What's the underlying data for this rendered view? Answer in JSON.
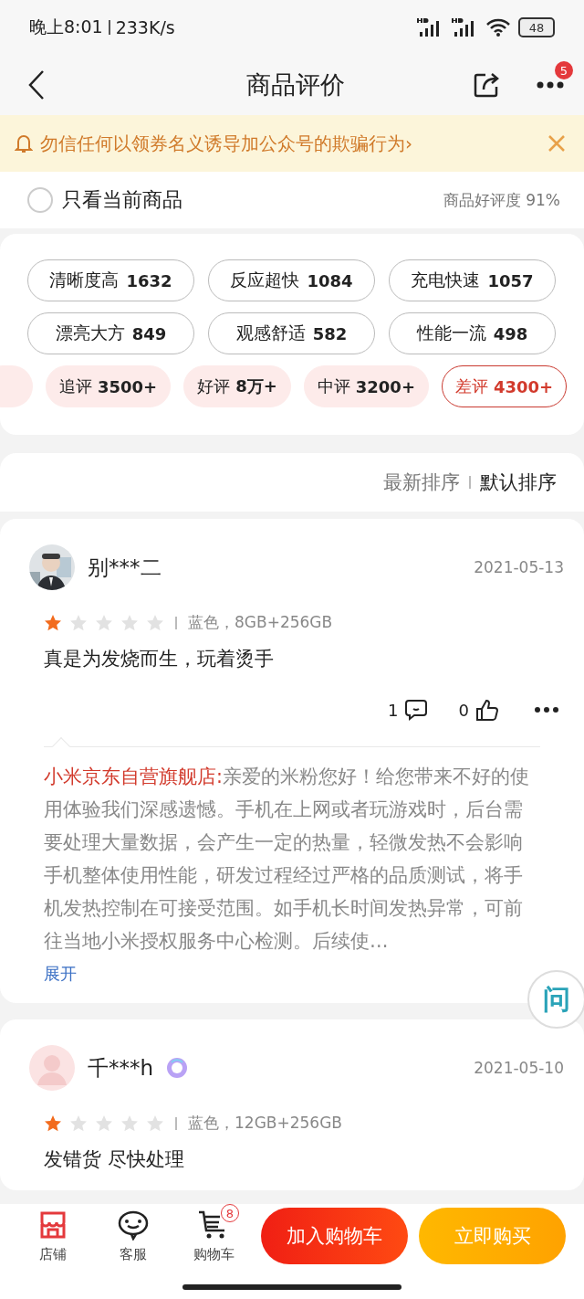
{
  "status_bar": {
    "time": "晚上8:01",
    "speed": "233K/s",
    "battery": "48"
  },
  "nav": {
    "title": "商品评价",
    "more_badge": "5"
  },
  "notice": {
    "text": "勿信任何以领券名义诱导加公众号的欺骗行为",
    "arrow": "›"
  },
  "filter": {
    "label": "只看当前商品",
    "checked": false,
    "rating": "商品好评度 91%"
  },
  "tags": [
    {
      "label": "清晰度高",
      "count": "1632"
    },
    {
      "label": "反应超快",
      "count": "1084"
    },
    {
      "label": "充电快速",
      "count": "1057"
    },
    {
      "label": "漂亮大方",
      "count": "849"
    },
    {
      "label": "观感舒适",
      "count": "582"
    },
    {
      "label": "性能一流",
      "count": "498"
    }
  ],
  "categories": [
    {
      "label": "追评",
      "count": "3500+",
      "selected": false
    },
    {
      "label": "好评",
      "count": "8万+",
      "selected": false
    },
    {
      "label": "中评",
      "count": "3200+",
      "selected": false
    },
    {
      "label": "差评",
      "count": "4300+",
      "selected": true
    }
  ],
  "sort": [
    {
      "label": "最新排序",
      "selected": false
    },
    {
      "label": "默认排序",
      "selected": true
    }
  ],
  "reviews": [
    {
      "name": "别***二",
      "verified": false,
      "date": "2021-05-13",
      "stars": 1,
      "spec": "蓝色，8GB+256GB",
      "text": "真是为发烧而生，玩着烫手",
      "comments": "1",
      "likes": "0",
      "reply": {
        "store": "小米京东自营旗舰店:",
        "text": "亲爱的米粉您好！给您带来不好的使用体验我们深感遗憾。手机在上网或者玩游戏时，后台需要处理大量数据，会产生一定的热量，轻微发热不会影响手机整体使用性能，研发过程经过严格的品质测试，将手机发热控制在可接受范围。如手机长时间发热异常，可前往当地小米授权服务中心检测。后续使…",
        "expand": "展开"
      }
    },
    {
      "avatar": {
        "kind": "default"
      },
      "name": "千***h",
      "verified": true,
      "date": "2021-05-10",
      "stars": 1,
      "spec": "蓝色，12GB+256GB",
      "text": "发错货 尽快处理"
    }
  ],
  "ask_button": "问",
  "bottom_bar": {
    "items": [
      {
        "kind": "store",
        "label": "店铺"
      },
      {
        "kind": "service",
        "label": "客服"
      },
      {
        "kind": "cart",
        "label": "购物车",
        "badge": "8"
      }
    ],
    "buttons": [
      {
        "kind": "cart",
        "label": "加入购物车"
      },
      {
        "kind": "buy",
        "label": "立即购买"
      }
    ]
  }
}
